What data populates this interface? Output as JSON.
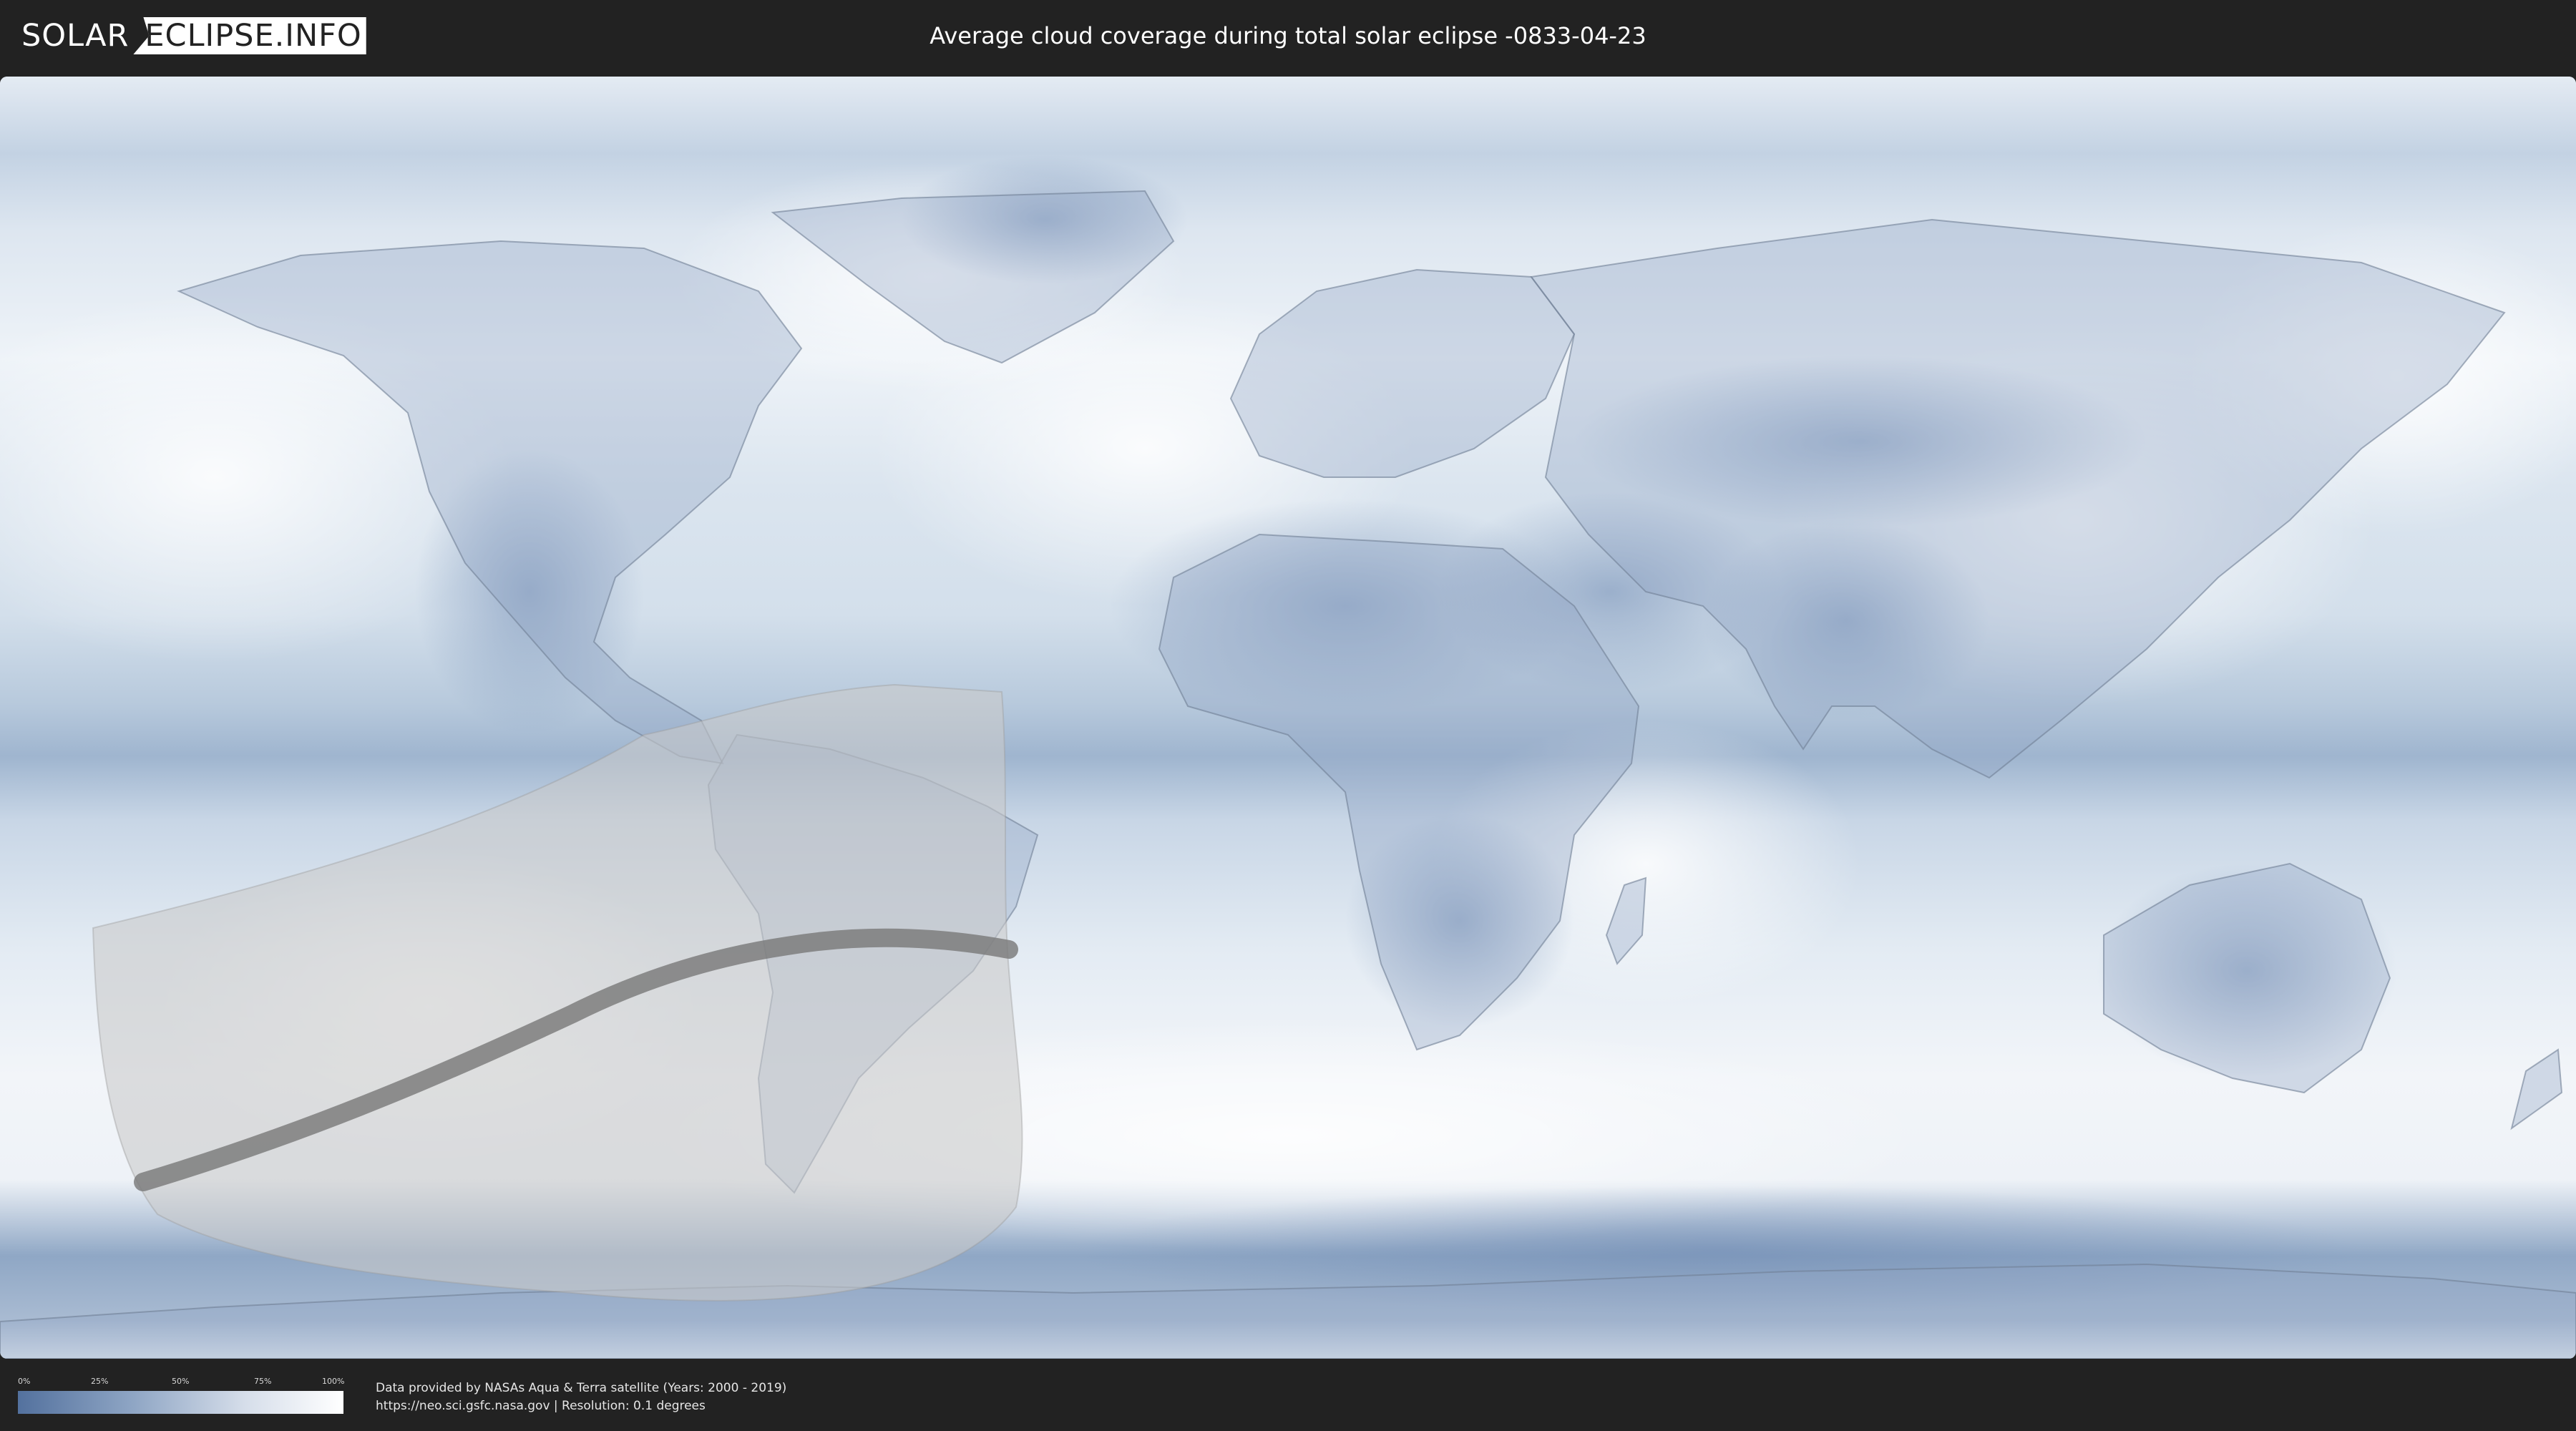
{
  "header": {
    "logo_left": "SOLAR",
    "logo_right": "ECLIPSE.INFO",
    "title": "Average cloud coverage during total solar eclipse -0833-04-23"
  },
  "legend": {
    "ticks": [
      "0%",
      "25%",
      "50%",
      "75%",
      "100%"
    ],
    "values": [
      0,
      25,
      50,
      75,
      100
    ]
  },
  "footer": {
    "credit_line1": "Data provided by NASAs Aqua & Terra satellite (Years: 2000 - 2019)",
    "credit_line2": "https://neo.sci.gsfc.nasa.gov | Resolution: 0.1 degrees"
  },
  "colors": {
    "background": "#222222",
    "cloud_low": "#53719e",
    "cloud_high": "#ffffff",
    "eclipse_zone": "#c9c9c9",
    "eclipse_path": "#7a7a7a"
  },
  "map": {
    "projection": "equirectangular",
    "layer": "average-cloud-coverage",
    "overlay": "eclipse-path"
  }
}
